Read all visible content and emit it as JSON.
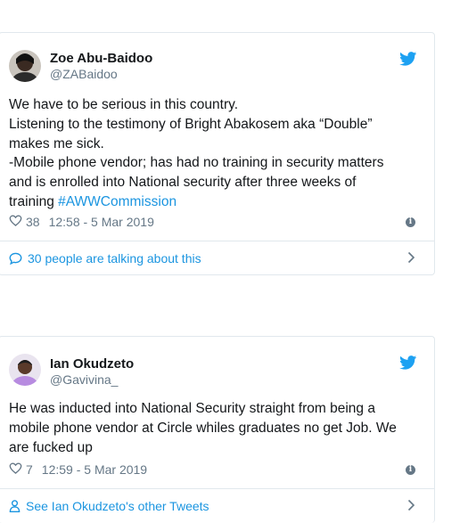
{
  "tweets": [
    {
      "author_name": "Zoe Abu-Baidoo",
      "handle": "@ZABaidoo",
      "lines": [
        "We have to be serious in this country.",
        "Listening to the testimony of Bright Abakosem aka “Double”",
        "makes me sick.",
        "-Mobile phone vendor; has had no training in security matters",
        "and is enrolled into National security after three weeks of"
      ],
      "last_line_text": "training ",
      "hashtag": "#AWWCommission",
      "likes": "38",
      "timestamp": "12:58 - 5 Mar 2019",
      "footer_text": "30 people are talking about this"
    },
    {
      "author_name": "Ian Okudzeto",
      "handle": "@Gavivina_",
      "lines": [
        "He was inducted into National Security straight from being a",
        "mobile phone vendor at Circle whiles graduates no get Job. We",
        "are fucked up"
      ],
      "likes": "7",
      "timestamp": "12:59 - 5 Mar 2019",
      "footer_text": "See Ian Okudzeto's other Tweets"
    }
  ],
  "colors": {
    "link": "#1b95e0",
    "secondary_text": "#657786",
    "twitter_blue": "#1da1f2",
    "border": "#e1e8ed"
  },
  "icons": {
    "brand": "twitter-bird-icon",
    "like": "heart-outline-icon",
    "info": "info-icon",
    "conversation": "speech-bubble-icon",
    "profile": "person-icon",
    "chevron": "chevron-right-icon"
  }
}
